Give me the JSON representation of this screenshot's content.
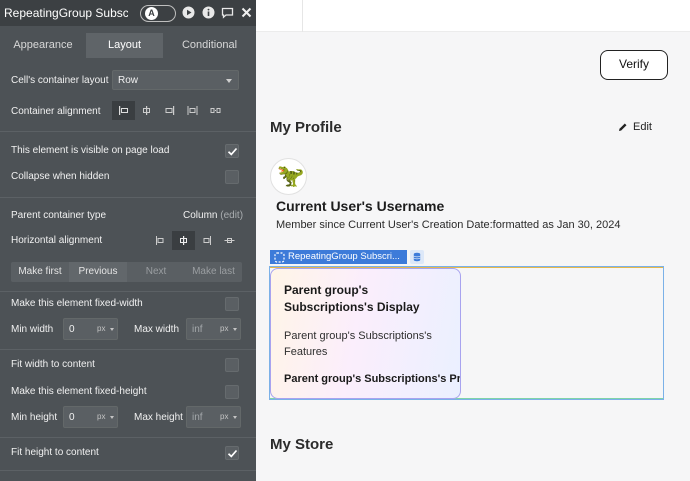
{
  "panel": {
    "title": "RepeatingGroup Subscri",
    "mode_badge": "A",
    "tabs": [
      {
        "label": "Appearance",
        "active": false
      },
      {
        "label": "Layout",
        "active": true
      },
      {
        "label": "Conditional",
        "active": false
      }
    ],
    "cell_layout": {
      "label": "Cell's container layout",
      "value": "Row"
    },
    "container_alignment": {
      "label": "Container alignment"
    },
    "visible_on_load": {
      "label": "This element is visible on page load",
      "checked": true
    },
    "collapse_hidden": {
      "label": "Collapse when hidden",
      "checked": false
    },
    "parent_type": {
      "label": "Parent container type",
      "value": "Column",
      "edit": "(edit)"
    },
    "horizontal_alignment": {
      "label": "Horizontal alignment"
    },
    "order_buttons": {
      "make_first": "Make first",
      "previous": "Previous",
      "next": "Next",
      "make_last": "Make last"
    },
    "fixed_width": {
      "label": "Make this element fixed-width",
      "checked": false
    },
    "min_width": {
      "label": "Min width",
      "value": "0",
      "unit": "px"
    },
    "max_width": {
      "label": "Max width",
      "value": "inf",
      "unit": "px"
    },
    "fit_width": {
      "label": "Fit width to content",
      "checked": false
    },
    "fixed_height": {
      "label": "Make this element fixed-height",
      "checked": false
    },
    "min_height": {
      "label": "Min height",
      "value": "0",
      "unit": "px"
    },
    "max_height": {
      "label": "Max height",
      "value": "inf",
      "unit": "px"
    },
    "fit_height": {
      "label": "Fit height to content",
      "checked": true
    }
  },
  "canvas": {
    "verify_button": "Verify",
    "my_profile": "My Profile",
    "edit": "Edit",
    "avatar_emoji": "🦖",
    "username": "Current User's Username",
    "member_since": "Member since Current User's Creation Date:formatted as Jan 30, 2024",
    "rg_label": "RepeatingGroup Subscri...",
    "card": {
      "title": "Parent group's Subscriptions's Display",
      "features": "Parent group's Subscriptions's Features",
      "price": "Parent group's Subscriptions's Pri"
    },
    "my_store": "My Store"
  },
  "colors": {
    "panel_bg": "#4d5256",
    "panel_header": "#3c4043",
    "accent_blue": "#3d7bd9",
    "card_border": "#a8a3ef"
  },
  "icons": [
    "play-icon",
    "info-icon",
    "comment-icon",
    "close-icon",
    "pencil-icon",
    "database-icon",
    "dashed-select-icon"
  ]
}
